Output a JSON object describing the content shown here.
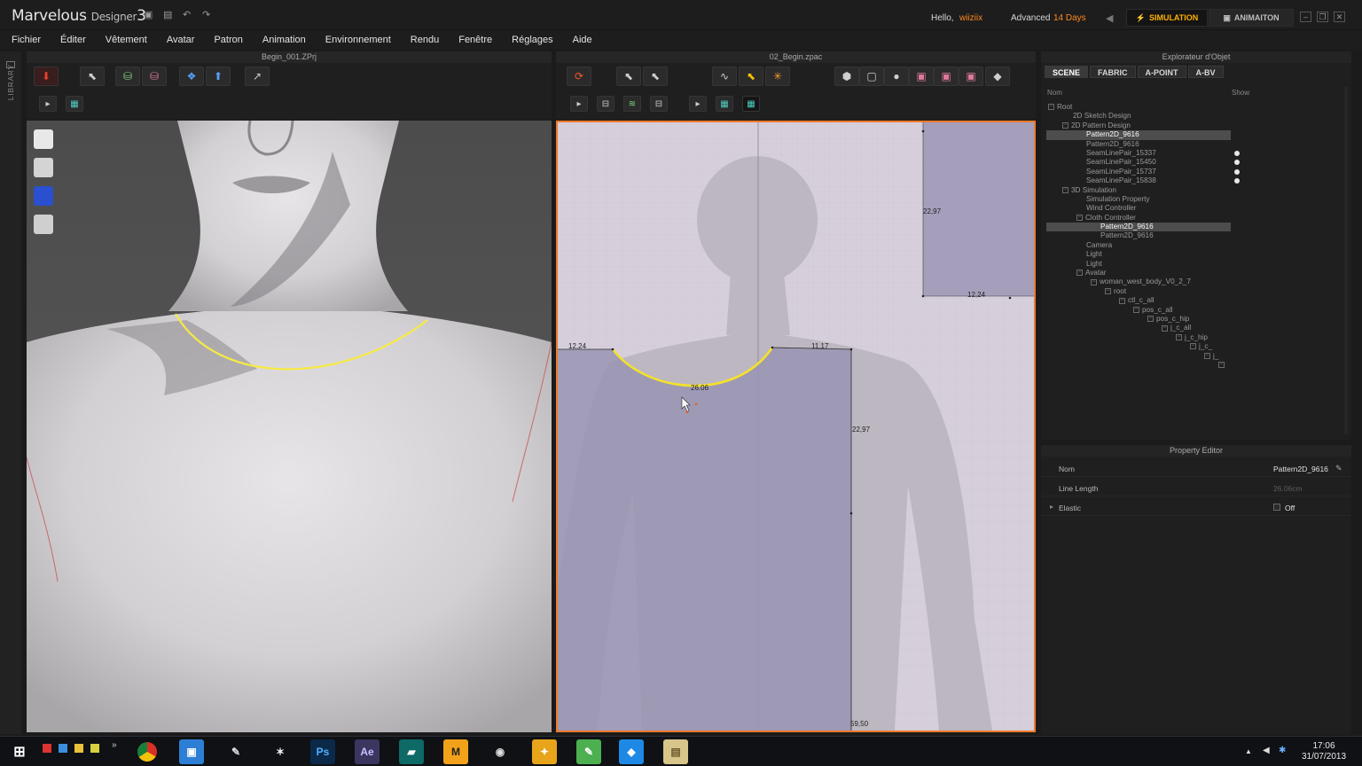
{
  "app": {
    "title_main": "Marvelous",
    "title_designer": "Designer",
    "title_version": "3",
    "hello": "Hello,",
    "user": "wiiziix",
    "plan": "Advanced",
    "days": "14 Days",
    "modes": [
      "SIMULATION",
      "ANIMAITON"
    ]
  },
  "menu": [
    "Fichier",
    "Éditer",
    "Vêtement",
    "Avatar",
    "Patron",
    "Animation",
    "Environnement",
    "Rendu",
    "Fenêtre",
    "Réglages",
    "Aide"
  ],
  "library_label": "LIBRARY",
  "panel3d": {
    "title": "Begin_001.ZPrj"
  },
  "panel2d": {
    "title": "02_Begin.zpac",
    "dims": {
      "neck_curve": "26.06",
      "left_shoulder": "12,24",
      "right_shoulder": "11,17",
      "side_length": "22,97",
      "top_rect_height": "22,97",
      "top_rect_width": "12,24",
      "bottom": "59,50"
    }
  },
  "explorer": {
    "title": "Explorateur d'Objet",
    "tabs": [
      "SCENE",
      "FABRIC",
      "A-POINT",
      "A-BV"
    ],
    "col_name": "Nom",
    "col_show": "Show",
    "tree": [
      {
        "label": "Root",
        "toggle": "⊟"
      },
      {
        "label": "2D Sketch Design"
      },
      {
        "label": "2D Pattern Design",
        "toggle": "⊟"
      },
      {
        "label": "Pattern2D_9616",
        "selected": true
      },
      {
        "label": "Pattern2D_9616"
      },
      {
        "label": "SeamLinePair_15337",
        "visible": true
      },
      {
        "label": "SeamLinePair_15450",
        "visible": true
      },
      {
        "label": "SeamLinePair_15737",
        "visible": true
      },
      {
        "label": "SeamLinePair_15838",
        "visible": true
      },
      {
        "label": "3D Simulation",
        "toggle": "⊟"
      },
      {
        "label": "Simulation Property"
      },
      {
        "label": "Wind Controller"
      },
      {
        "label": "Cloth Controller",
        "toggle": "⊟"
      },
      {
        "label": "Pattern2D_9616",
        "selected": true
      },
      {
        "label": "Pattern2D_9616"
      },
      {
        "label": "Camera"
      },
      {
        "label": "Light"
      },
      {
        "label": "Light"
      },
      {
        "label": "Avatar",
        "toggle": "⊟"
      },
      {
        "label": "woman_west_body_V0_2_7",
        "toggle": "⊟"
      },
      {
        "label": "root",
        "toggle": "⊟"
      },
      {
        "label": "ctl_c_all",
        "toggle": "⊟"
      },
      {
        "label": "pos_c_all",
        "toggle": "⊟"
      },
      {
        "label": "pos_c_hip",
        "toggle": "⊟"
      },
      {
        "label": "j_c_all",
        "toggle": "⊟"
      },
      {
        "label": "j_c_hip",
        "toggle": "⊟"
      },
      {
        "label": "j_c_",
        "toggle": "⊟"
      },
      {
        "label": "j_",
        "toggle": "⊟"
      },
      {
        "label": "",
        "toggle": "⊟"
      }
    ]
  },
  "property_editor": {
    "title": "Property Editor",
    "rows": [
      {
        "key": "Nom",
        "value": "Pattern2D_9616"
      },
      {
        "key": "Line Length",
        "value": "26.06cm"
      },
      {
        "key": "Elastic",
        "value": "Off"
      }
    ]
  },
  "taskbar": {
    "apps": [
      "Ps",
      "Ae",
      "M"
    ],
    "time": "17:06",
    "date": "31/07/2013"
  }
}
